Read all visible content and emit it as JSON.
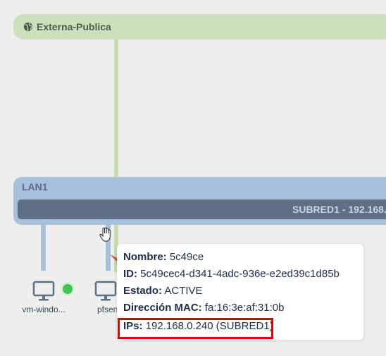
{
  "external_network": {
    "label": "Externa-Publica"
  },
  "lan": {
    "label": "LAN1",
    "subnet_label": "SUBRED1 - 192.168."
  },
  "vms": [
    {
      "name": "vm-windo...",
      "status": "running"
    },
    {
      "name": "pfsen"
    }
  ],
  "tooltip": {
    "nombre_label": "Nombre:",
    "nombre_value": "5c49ce",
    "id_label": "ID:",
    "id_value": "5c49cec4-d341-4adc-936e-e2ed39c1d85b",
    "estado_label": "Estado:",
    "estado_value": "ACTIVE",
    "mac_label": "Dirección MAC:",
    "mac_value": "fa:16:3e:af:31:0b",
    "ips_label": "IPs:",
    "ips_value": "192.168.0.240 (SUBRED1)"
  },
  "colors": {
    "external": "#cde0bc",
    "lan": "#a7c1dc",
    "subnet": "#5f7086",
    "status_ok": "#3ec553",
    "highlight": "#e00000"
  }
}
